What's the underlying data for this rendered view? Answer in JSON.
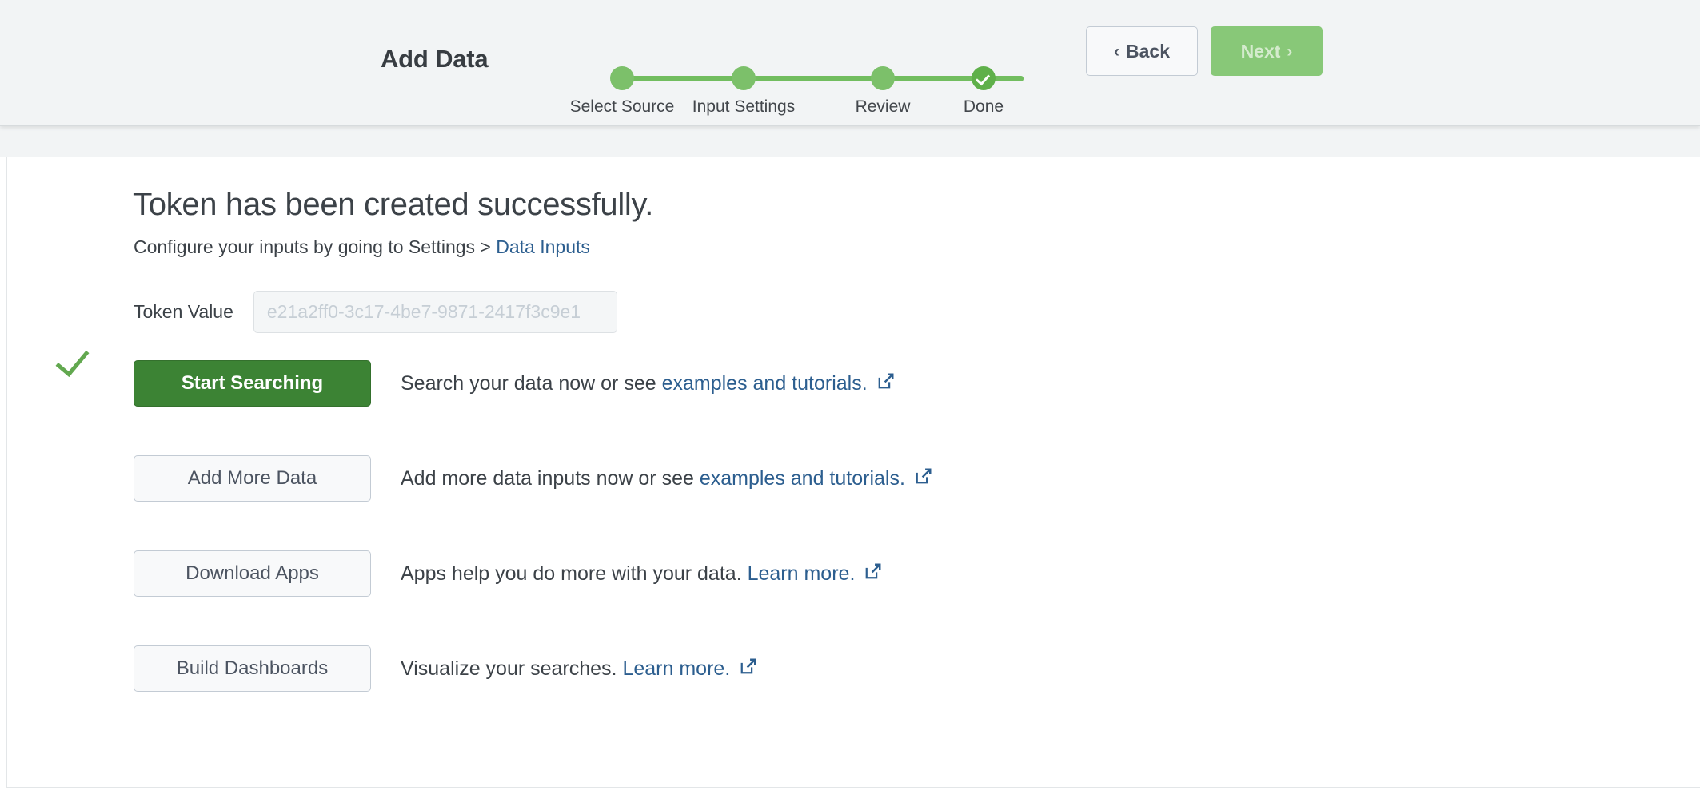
{
  "wizard": {
    "title": "Add Data",
    "steps": [
      {
        "label": "Select Source",
        "state": "complete"
      },
      {
        "label": "Input Settings",
        "state": "complete"
      },
      {
        "label": "Review",
        "state": "complete"
      },
      {
        "label": "Done",
        "state": "current-done"
      }
    ],
    "back_label": "Back",
    "back_chevron": "‹",
    "next_label": "Next",
    "next_chevron": "›",
    "next_disabled": true
  },
  "main": {
    "headline": "Token has been created successfully.",
    "subline_prefix": "Configure your inputs by going to Settings > ",
    "subline_link": "Data Inputs",
    "token_label": "Token Value",
    "token_value": "e21a2ff0-3c17-4be7-9871-2417f3c9e1",
    "actions": [
      {
        "button_label": "Start Searching",
        "style": "primary",
        "text_prefix": "Search your data now or see ",
        "link_text": "examples and tutorials.",
        "external_icon": "external-link-icon"
      },
      {
        "button_label": "Add More Data",
        "style": "secondary",
        "text_prefix": "Add more data inputs now or see ",
        "link_text": "examples and tutorials.",
        "external_icon": "external-link-icon"
      },
      {
        "button_label": "Download Apps",
        "style": "secondary",
        "text_prefix": "Apps help you do more with your data. ",
        "link_text": "Learn more.",
        "external_icon": "external-link-icon"
      },
      {
        "button_label": "Build Dashboards",
        "style": "secondary",
        "text_prefix": "Visualize your searches. ",
        "link_text": "Learn more.",
        "external_icon": "external-link-icon"
      }
    ]
  },
  "colors": {
    "step_green": "#7cc06a",
    "step_done_green": "#5fb04a",
    "track_green": "#72bd5f",
    "primary_button_green": "#3c8334",
    "next_disabled_green": "#88c878",
    "link_blue": "#2c5e8f",
    "check_green": "#62a84f",
    "header_bg": "#f2f4f5"
  }
}
